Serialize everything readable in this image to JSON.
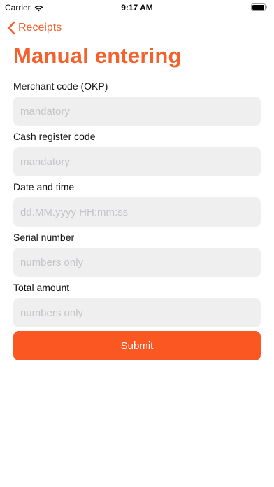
{
  "status_bar": {
    "carrier": "Carrier",
    "time": "9:17 AM"
  },
  "nav": {
    "back_label": "Receipts"
  },
  "page": {
    "title": "Manual entering"
  },
  "form": {
    "fields": [
      {
        "label": "Merchant code (OKP)",
        "value": "",
        "placeholder": "mandatory"
      },
      {
        "label": "Cash register code",
        "value": "",
        "placeholder": "mandatory"
      },
      {
        "label": "Date and time",
        "value": "",
        "placeholder": "dd.MM.yyyy HH:mm:ss"
      },
      {
        "label": "Serial number",
        "value": "",
        "placeholder": "numbers only"
      },
      {
        "label": "Total amount",
        "value": "",
        "placeholder": "numbers only"
      }
    ],
    "submit_label": "Submit"
  },
  "colors": {
    "accent": "#f2622e",
    "button": "#fa5722",
    "input_background": "#efeff0",
    "placeholder": "#c4c4c8"
  }
}
